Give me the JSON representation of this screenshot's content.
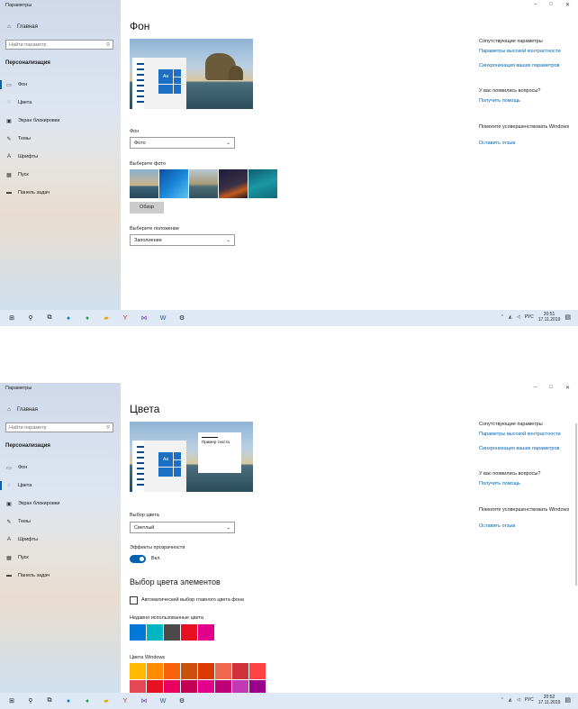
{
  "window_title": "Параметры",
  "titlebar": {
    "minimize": "–",
    "maximize": "□",
    "close": "✕"
  },
  "sidebar": {
    "home": "Главная",
    "search_placeholder": "Найти параметр",
    "section": "Персонализация",
    "items": [
      {
        "label": "Фон",
        "icon": "image-icon"
      },
      {
        "label": "Цвета",
        "icon": "palette-icon"
      },
      {
        "label": "Экран блокировки",
        "icon": "lock-screen-icon"
      },
      {
        "label": "Темы",
        "icon": "brush-icon"
      },
      {
        "label": "Шрифты",
        "icon": "font-icon"
      },
      {
        "label": "Пуск",
        "icon": "start-icon"
      },
      {
        "label": "Панель задач",
        "icon": "taskbar-icon"
      }
    ]
  },
  "screen1": {
    "title": "Фон",
    "bg_label": "Фон",
    "bg_value": "Фото",
    "choose_photo": "Выберите фото",
    "browse": "Обзор",
    "position_label": "Выберите положение",
    "position_value": "Заполнение",
    "preview_tile": "Aa",
    "active_item": 0
  },
  "screen2": {
    "title": "Цвета",
    "preview_tile": "Aa",
    "preview_card_text": "Пример текста",
    "color_choice_label": "Выбор цвета",
    "color_choice_value": "Светлый",
    "transparency_label": "Эффекты прозрачности",
    "transparency_value": "Вкл.",
    "accent_title": "Выбор цвета элементов",
    "auto_accent": "Автоматический выбор главного цвета фона",
    "recent_label": "Недавно использованные цвета",
    "recent_colors": [
      "#0078d7",
      "#00b7c3",
      "#4c4a48",
      "#e81123",
      "#e3008c"
    ],
    "windows_colors_label": "Цвета Windows",
    "windows_colors_row1": [
      "#ffb900",
      "#ff8c00",
      "#f7630c",
      "#ca5010",
      "#da3b01",
      "#ef6950",
      "#d13438",
      "#ff4343"
    ],
    "windows_colors_row2": [
      "#e74856",
      "#e81123",
      "#ea005e",
      "#c30052",
      "#e3008c",
      "#bf0077",
      "#c239b3",
      "#9a0089"
    ],
    "active_item": 1
  },
  "right_panel": {
    "related_title": "Сопутствующие параметры",
    "link_contrast": "Параметры высокой контрастности",
    "link_sync": "Синхронизация ваших параметров",
    "questions_title": "У вас появились вопросы?",
    "link_help": "Получить помощь",
    "improve_title": "Помогите усовершенствовать Windows",
    "link_feedback": "Оставить отзыв"
  },
  "taskbar1": {
    "lang": "РУС",
    "time": "20:51",
    "date": "17.11.2019"
  },
  "taskbar2": {
    "lang": "РУС",
    "time": "20:52",
    "date": "17.11.2019"
  },
  "colors": {
    "accent": "#0063b1",
    "link": "#0067b8",
    "taskbar": "#dfe9f5"
  }
}
